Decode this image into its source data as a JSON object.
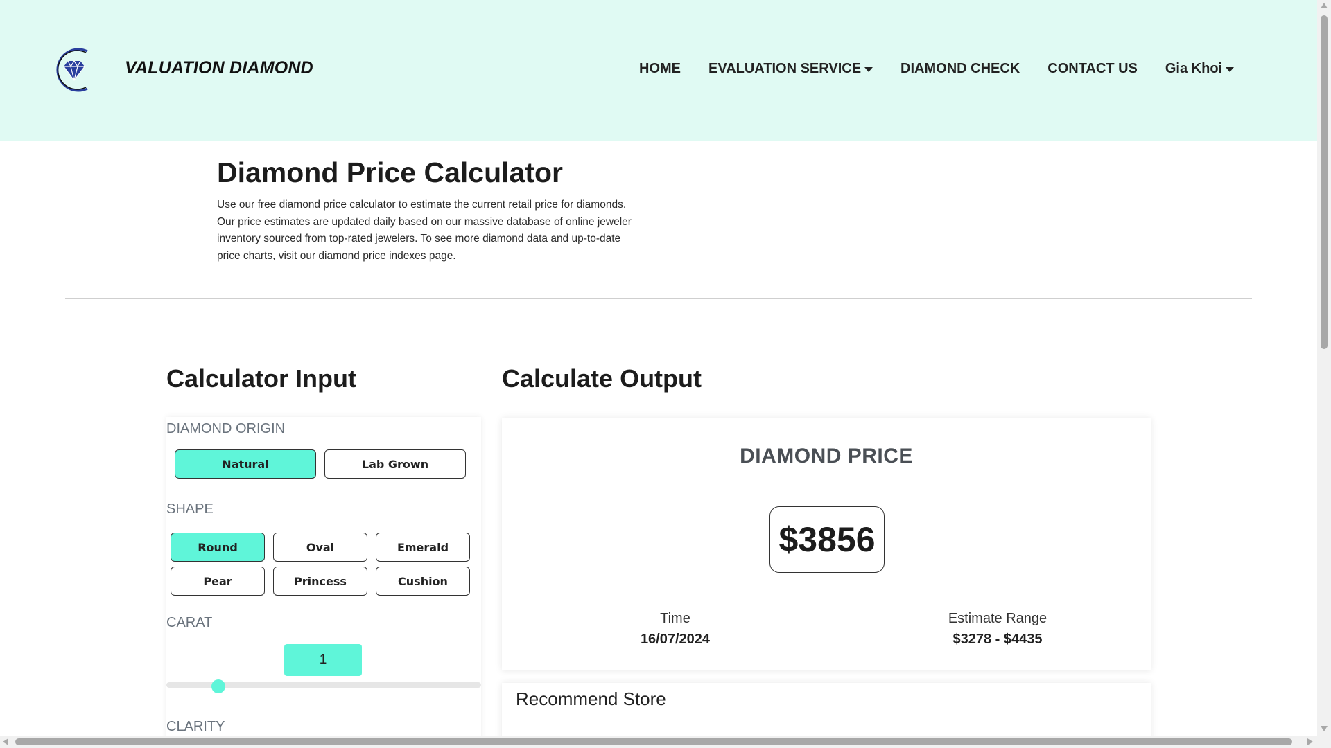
{
  "header": {
    "brand": "VALUATION DIAMOND",
    "logo_icon": "diamond-icon",
    "nav": {
      "home": "HOME",
      "evaluation_service": "EVALUATION SERVICE",
      "diamond_check": "DIAMOND CHECK",
      "contact_us": "CONTACT US",
      "user": "Gia Khoi"
    }
  },
  "intro": {
    "title": "Diamond Price Calculator",
    "description": "Use our free diamond price calculator to estimate the current retail price for diamonds. Our price estimates are updated daily based on our massive database of online jeweler inventory sourced from top-rated jewelers. To see more diamond data and up-to-date price charts, visit our diamond price indexes page."
  },
  "calculator_input": {
    "title": "Calculator Input",
    "origin": {
      "label": "DIAMOND ORIGIN",
      "options": [
        "Natural",
        "Lab Grown"
      ],
      "selected": "Natural"
    },
    "shape": {
      "label": "SHAPE",
      "options": [
        "Round",
        "Oval",
        "Emerald",
        "Pear",
        "Princess",
        "Cushion"
      ],
      "selected": "Round"
    },
    "carat": {
      "label": "CARAT",
      "value": "1"
    },
    "clarity": {
      "label": "CLARITY"
    }
  },
  "calculate_output": {
    "title": "Calculate Output",
    "price_title": "DIAMOND PRICE",
    "price": "$3856",
    "time_label": "Time",
    "time_value": "16/07/2024",
    "range_label": "Estimate Range",
    "range_value": "$3278 - $4435",
    "recommend_store_title": "Recommend Store"
  },
  "colors": {
    "header_bg": "#e0faf3",
    "accent": "#5ff5d9",
    "logo_blue": "#2a3f9e"
  }
}
